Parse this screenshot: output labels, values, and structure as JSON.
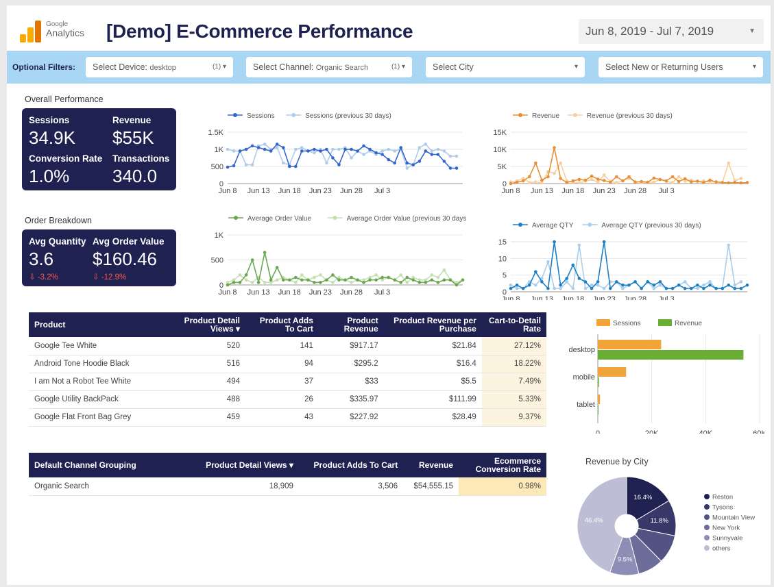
{
  "header": {
    "brand_line1": "Google",
    "brand_line2": "Analytics",
    "title": "[Demo] E-Commerce Performance",
    "date_range": "Jun 8, 2019 - Jul 7, 2019"
  },
  "filters": {
    "label": "Optional Filters:",
    "device": {
      "label": "Select Device:",
      "value": "desktop",
      "count": "(1) ▾"
    },
    "channel": {
      "label": "Select Channel:",
      "value": "Organic Search",
      "count": "(1) ▾"
    },
    "city": {
      "label": "Select City"
    },
    "users": {
      "label": "Select New or Returning Users"
    }
  },
  "overall": {
    "title": "Overall Performance",
    "sessions_label": "Sessions",
    "sessions_value": "34.9K",
    "revenue_label": "Revenue",
    "revenue_value": "$55K",
    "conv_label": "Conversion Rate",
    "conv_value": "1.0%",
    "trans_label": "Transactions",
    "trans_value": "340.0"
  },
  "orders": {
    "title": "Order Breakdown",
    "qty_label": "Avg Quantity",
    "qty_value": "3.6",
    "qty_delta": "⇩ -3.2%",
    "aov_label": "Avg Order Value",
    "aov_value": "$160.46",
    "aov_delta": "⇩ -12.9%"
  },
  "colors": {
    "navy": "#1f2251",
    "sessions": "#3366cc",
    "sessions_prev": "#aecbea",
    "revenue": "#e69138",
    "revenue_prev": "#f6cfa0",
    "aov": "#6aa84f",
    "aov_prev": "#c4dfb0",
    "qty": "#1c7fc4",
    "qty_prev": "#a9cdea",
    "bar_sessions": "#f0a43a",
    "bar_revenue": "#6aae35",
    "pie": [
      "#1f2251",
      "#383969",
      "#525283",
      "#6d6d9a",
      "#8d8db5",
      "#bdbdd6"
    ]
  },
  "chart_data": [
    {
      "type": "line",
      "series": [
        {
          "name": "Sessions",
          "values": [
            480,
            520,
            950,
            1000,
            1100,
            1050,
            1000,
            950,
            1150,
            1050,
            500,
            500,
            950,
            950,
            1000,
            950,
            1000,
            750,
            550,
            1000,
            1000,
            950,
            1100,
            1000,
            900,
            850,
            700,
            600,
            1050,
            600,
            550,
            650,
            950,
            850,
            850,
            650,
            450,
            450
          ]
        },
        {
          "name": "Sessions (previous 30 days)",
          "values": [
            1000,
            950,
            950,
            550,
            550,
            1100,
            1150,
            1000,
            1050,
            600,
            550,
            1000,
            1050,
            950,
            900,
            1000,
            600,
            1000,
            1000,
            1050,
            750,
            950,
            850,
            950,
            850,
            950,
            1000,
            950,
            1000,
            450,
            550,
            1050,
            1150,
            950,
            1000,
            950,
            800,
            800
          ]
        }
      ],
      "x_ticks": [
        "Jun 8",
        "Jun 13",
        "Jun 18",
        "Jun 23",
        "Jun 28",
        "Jul 3"
      ],
      "y_ticks": [
        "1.5K",
        "1K",
        "500",
        "0"
      ],
      "ylim": [
        0,
        1500
      ]
    },
    {
      "type": "line",
      "series": [
        {
          "name": "Revenue",
          "values": [
            0,
            400,
            800,
            2000,
            6000,
            1000,
            2000,
            10500,
            1500,
            300,
            800,
            1200,
            1000,
            2200,
            1300,
            900,
            400,
            2000,
            800,
            2000,
            400,
            600,
            400,
            1600,
            1200,
            800,
            2000,
            600,
            1400,
            500,
            700,
            300,
            1000,
            500,
            300,
            200,
            300,
            200,
            300
          ]
        },
        {
          "name": "Revenue (previous 30 days)",
          "values": [
            500,
            800,
            1500,
            300,
            500,
            200,
            3500,
            3000,
            6000,
            800,
            400,
            200,
            700,
            1200,
            400,
            2500,
            600,
            300,
            800,
            1500,
            600,
            300,
            300,
            400,
            1200,
            600,
            300,
            2000,
            700,
            1000,
            600,
            800,
            400,
            500,
            300,
            6000,
            800,
            1500
          ]
        }
      ],
      "x_ticks": [
        "Jun 8",
        "Jun 13",
        "Jun 18",
        "Jun 23",
        "Jun 28",
        "Jul 3"
      ],
      "y_ticks": [
        "15K",
        "10K",
        "5K",
        "0"
      ],
      "ylim": [
        0,
        15000
      ]
    },
    {
      "type": "line",
      "series": [
        {
          "name": "Average Order Value",
          "values": [
            0,
            50,
            50,
            200,
            500,
            50,
            650,
            100,
            350,
            100,
            100,
            150,
            100,
            100,
            50,
            50,
            100,
            200,
            100,
            100,
            150,
            100,
            50,
            100,
            100,
            150,
            150,
            100,
            50,
            150,
            100,
            50,
            50,
            100,
            50,
            100,
            100,
            0,
            100
          ]
        },
        {
          "name": "Average Order Value (previous 30 days)",
          "values": [
            50,
            100,
            200,
            100,
            50,
            150,
            50,
            50,
            100,
            150,
            100,
            50,
            200,
            100,
            150,
            200,
            100,
            50,
            150,
            100,
            50,
            100,
            100,
            150,
            200,
            100,
            150,
            100,
            200,
            50,
            150,
            100,
            100,
            200,
            150,
            300,
            100,
            50,
            100
          ]
        }
      ],
      "x_ticks": [
        "Jun 8",
        "Jun 13",
        "Jun 18",
        "Jun 23",
        "Jun 28",
        "Jul 3"
      ],
      "y_ticks": [
        "1K",
        "500",
        "0"
      ],
      "ylim": [
        0,
        1000
      ]
    },
    {
      "type": "line",
      "series": [
        {
          "name": "Average QTY",
          "values": [
            1,
            2,
            1,
            2,
            6,
            3,
            1,
            15,
            2,
            4,
            8,
            4,
            3,
            1,
            3,
            15,
            1,
            3,
            2,
            2,
            3,
            1,
            3,
            2,
            3,
            1,
            1,
            2,
            1,
            1,
            2,
            1,
            2,
            1,
            1,
            2,
            1,
            1,
            2
          ]
        },
        {
          "name": "Average QTY (previous 30 days)",
          "values": [
            2,
            1,
            1,
            3,
            2,
            4,
            9,
            1,
            1,
            3,
            1,
            14,
            1,
            2,
            2,
            1,
            3,
            3,
            1,
            2,
            3,
            1,
            3,
            1,
            2,
            1,
            1,
            2,
            3,
            1,
            1,
            2,
            3,
            1,
            1,
            14,
            2,
            3
          ]
        }
      ],
      "x_ticks": [
        "Jun 8",
        "Jun 13",
        "Jun 18",
        "Jun 23",
        "Jun 28",
        "Jul 3"
      ],
      "y_ticks": [
        "15",
        "10",
        "5",
        "0"
      ],
      "ylim": [
        0,
        15
      ]
    },
    {
      "type": "bar",
      "categories": [
        "desktop",
        "mobile",
        "tablet"
      ],
      "series": [
        {
          "name": "Sessions",
          "values": [
            23500,
            10500,
            800
          ]
        },
        {
          "name": "Revenue",
          "values": [
            54000,
            400,
            100
          ]
        }
      ],
      "x_ticks": [
        "0",
        "20K",
        "40K",
        "60K"
      ],
      "xlim": [
        0,
        60000
      ]
    },
    {
      "type": "pie",
      "title": "Revenue by City",
      "labels": [
        "Reston",
        "Tysons",
        "Mountain View",
        "New York",
        "Sunnyvale",
        "others"
      ],
      "values": [
        16.4,
        11.8,
        9.4,
        8.4,
        9.5,
        44.5
      ],
      "data_labels": [
        "16.4%",
        "11.8%",
        "",
        "",
        "9.5%",
        "46.4%"
      ]
    },
    {
      "type": "table",
      "columns": [
        "Product",
        "Product Detail Views ▾",
        "Product Adds To Cart",
        "Product Revenue",
        "Product Revenue per Purchase",
        "Cart-to-Detail Rate"
      ],
      "rows": [
        [
          "Google Tee White",
          "520",
          "141",
          "$917.17",
          "$21.84",
          "27.12%"
        ],
        [
          "Android Tone Hoodie Black",
          "516",
          "94",
          "$295.2",
          "$16.4",
          "18.22%"
        ],
        [
          "I am Not a Robot Tee White",
          "494",
          "37",
          "$33",
          "$5.5",
          "7.49%"
        ],
        [
          "Google Utility BackPack",
          "488",
          "26",
          "$335.97",
          "$111.99",
          "5.33%"
        ],
        [
          "Google Flat Front Bag Grey",
          "459",
          "43",
          "$227.92",
          "$28.49",
          "9.37%"
        ]
      ]
    },
    {
      "type": "table",
      "columns": [
        "Default Channel Grouping",
        "Product Detail Views ▾",
        "Product Adds To Cart",
        "Revenue",
        "Ecommerce Conversion Rate"
      ],
      "rows": [
        [
          "Organic Search",
          "18,909",
          "3,506",
          "$54,555.15",
          "0.98%"
        ]
      ]
    }
  ]
}
